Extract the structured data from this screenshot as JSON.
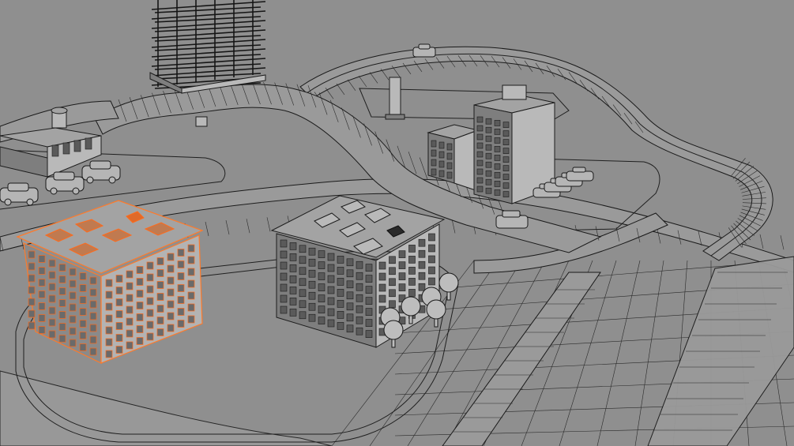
{
  "viewport": {
    "background": "#8f8f8f",
    "wire_color": "#1f1f1f",
    "selection_color": "#ff7a2a",
    "mode": "wireframe"
  },
  "objects": [
    {
      "name": "scaffold-tower"
    },
    {
      "name": "overpass-road"
    },
    {
      "name": "elevated-highway"
    },
    {
      "name": "office-building-back"
    },
    {
      "name": "apartment-building-center"
    },
    {
      "name": "selected-building"
    },
    {
      "name": "shop-building-left"
    },
    {
      "name": "parked-cars"
    },
    {
      "name": "street-trees"
    }
  ],
  "selection": {
    "object": "selected-building",
    "highlight": "#ff7a2a"
  }
}
